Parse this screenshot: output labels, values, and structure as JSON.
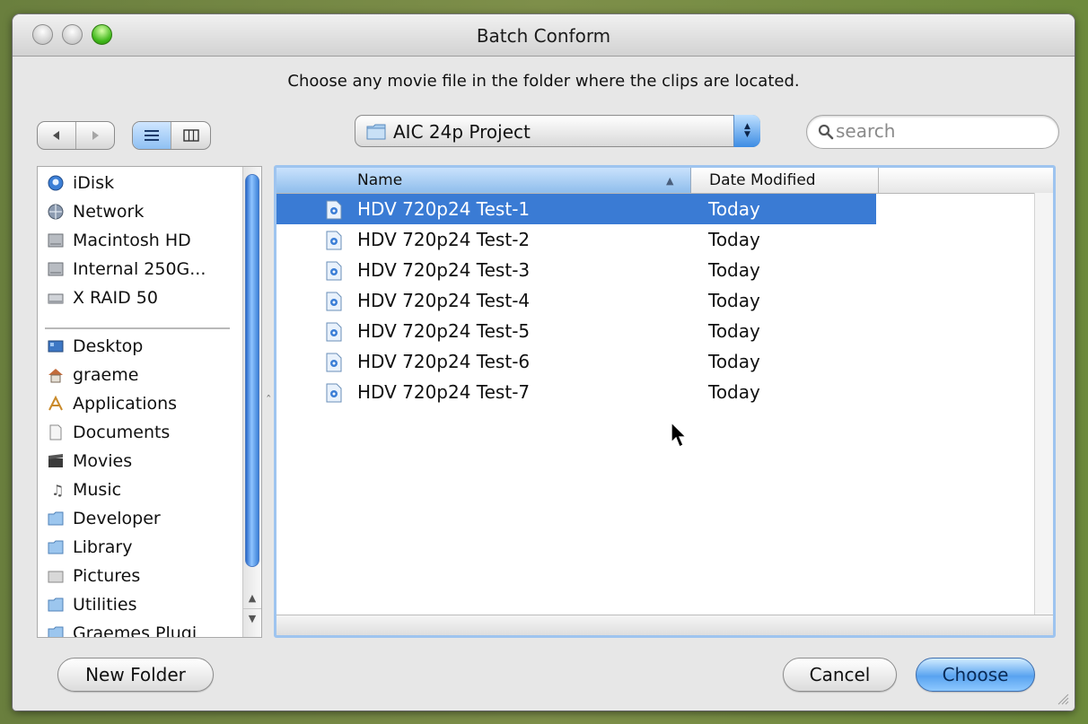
{
  "window": {
    "title": "Batch Conform"
  },
  "prompt": "Choose any movie file in the folder where the clips are located.",
  "toolbar": {
    "back_icon": "back-arrow-icon",
    "forward_icon": "forward-arrow-icon",
    "view_list_icon": "list-view-icon",
    "view_column_icon": "column-view-icon",
    "location": "AIC 24p Project",
    "search_placeholder": "search"
  },
  "sidebar": {
    "devices": [
      {
        "label": "iDisk",
        "icon": "idisk-icon"
      },
      {
        "label": "Network",
        "icon": "network-icon"
      },
      {
        "label": "Macintosh HD",
        "icon": "hard-drive-icon"
      },
      {
        "label": "Internal 250G...",
        "icon": "hard-drive-icon"
      },
      {
        "label": "X RAID 50",
        "icon": "external-drive-icon"
      }
    ],
    "places": [
      {
        "label": "Desktop",
        "icon": "desktop-icon"
      },
      {
        "label": "graeme",
        "icon": "home-icon"
      },
      {
        "label": "Applications",
        "icon": "applications-icon"
      },
      {
        "label": "Documents",
        "icon": "documents-icon"
      },
      {
        "label": "Movies",
        "icon": "movies-icon"
      },
      {
        "label": "Music",
        "icon": "music-icon"
      },
      {
        "label": "Developer",
        "icon": "folder-icon"
      },
      {
        "label": "Library",
        "icon": "folder-icon"
      },
      {
        "label": "Pictures",
        "icon": "pictures-icon"
      },
      {
        "label": "Utilities",
        "icon": "folder-icon"
      },
      {
        "label": "Graemes Plugi",
        "icon": "folder-icon"
      }
    ]
  },
  "filelist": {
    "columns": {
      "name": "Name",
      "date": "Date Modified"
    },
    "sort": "name ascending",
    "rows": [
      {
        "name": "HDV 720p24 Test-1",
        "date": "Today",
        "selected": true
      },
      {
        "name": "HDV 720p24 Test-2",
        "date": "Today",
        "selected": false
      },
      {
        "name": "HDV 720p24 Test-3",
        "date": "Today",
        "selected": false
      },
      {
        "name": "HDV 720p24 Test-4",
        "date": "Today",
        "selected": false
      },
      {
        "name": "HDV 720p24 Test-5",
        "date": "Today",
        "selected": false
      },
      {
        "name": "HDV 720p24 Test-6",
        "date": "Today",
        "selected": false
      },
      {
        "name": "HDV 720p24 Test-7",
        "date": "Today",
        "selected": false
      }
    ]
  },
  "buttons": {
    "new_folder": "New Folder",
    "cancel": "Cancel",
    "choose": "Choose"
  },
  "colors": {
    "selection": "#3a7bd4",
    "accent": "#59a3f0"
  }
}
